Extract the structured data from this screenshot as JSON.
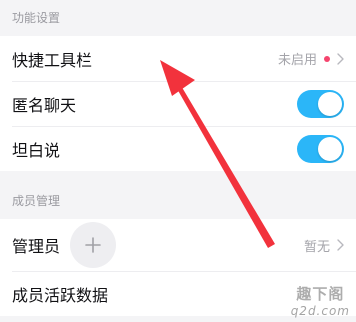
{
  "sections": {
    "features": {
      "header": "功能设置",
      "rows": {
        "quick_toolbar": {
          "label": "快捷工具栏",
          "status": "未启用"
        },
        "anonymous_chat": {
          "label": "匿名聊天",
          "toggle_on": true
        },
        "confession": {
          "label": "坦白说",
          "toggle_on": true
        }
      }
    },
    "members": {
      "header": "成员管理",
      "rows": {
        "admin": {
          "label": "管理员",
          "status": "暂无"
        },
        "active_data": {
          "label": "成员活跃数据"
        }
      }
    }
  },
  "icons": {
    "chevron": "chevron-right-icon",
    "add": "plus-icon",
    "dot": "red-dot-icon"
  },
  "colors": {
    "toggle_on": "#2bb6f8",
    "red_dot": "#f5456e",
    "annotation_arrow": "#f2323c"
  },
  "watermark": {
    "top": "趣下阁",
    "bottom": "q2d.com"
  }
}
